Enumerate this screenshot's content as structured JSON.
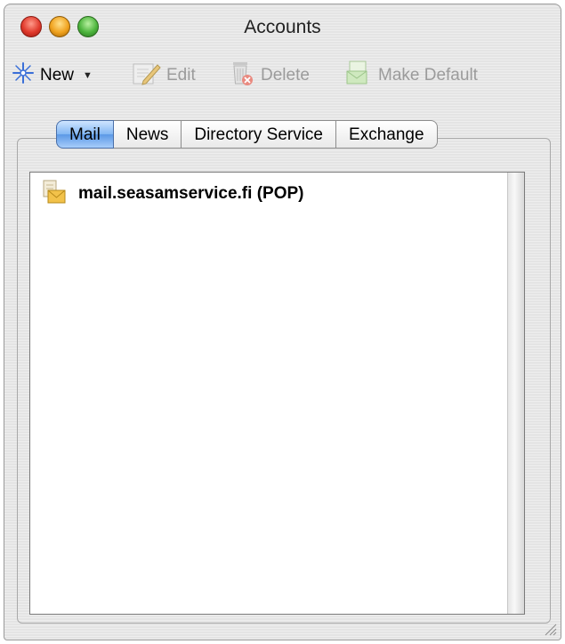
{
  "window": {
    "title": "Accounts"
  },
  "toolbar": {
    "new_label": "New",
    "edit_label": "Edit",
    "delete_label": "Delete",
    "make_default_label": "Make Default"
  },
  "tabs": [
    {
      "label": "Mail",
      "active": true
    },
    {
      "label": "News",
      "active": false
    },
    {
      "label": "Directory Service",
      "active": false
    },
    {
      "label": "Exchange",
      "active": false
    }
  ],
  "accounts": [
    {
      "label": "mail.seasamservice.fi (POP)",
      "icon": "mail-account-icon"
    }
  ],
  "colors": {
    "active_tab": "#6aa6ee",
    "close": "#e0392b",
    "minimize": "#f0a21e",
    "zoom": "#4cb43c"
  }
}
